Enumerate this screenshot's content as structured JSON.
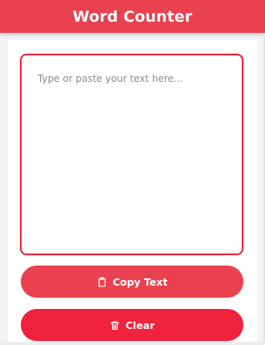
{
  "header": {
    "title": "Word Counter"
  },
  "editor": {
    "placeholder": "Type or paste your text here...",
    "value": ""
  },
  "buttons": {
    "copy": {
      "label": "Copy Text",
      "icon": "clipboard-icon"
    },
    "clear": {
      "label": "Clear",
      "icon": "trash-icon"
    }
  },
  "colors": {
    "accent": "#e9414f",
    "border": "#e8223d",
    "clear": "#f0223d"
  }
}
